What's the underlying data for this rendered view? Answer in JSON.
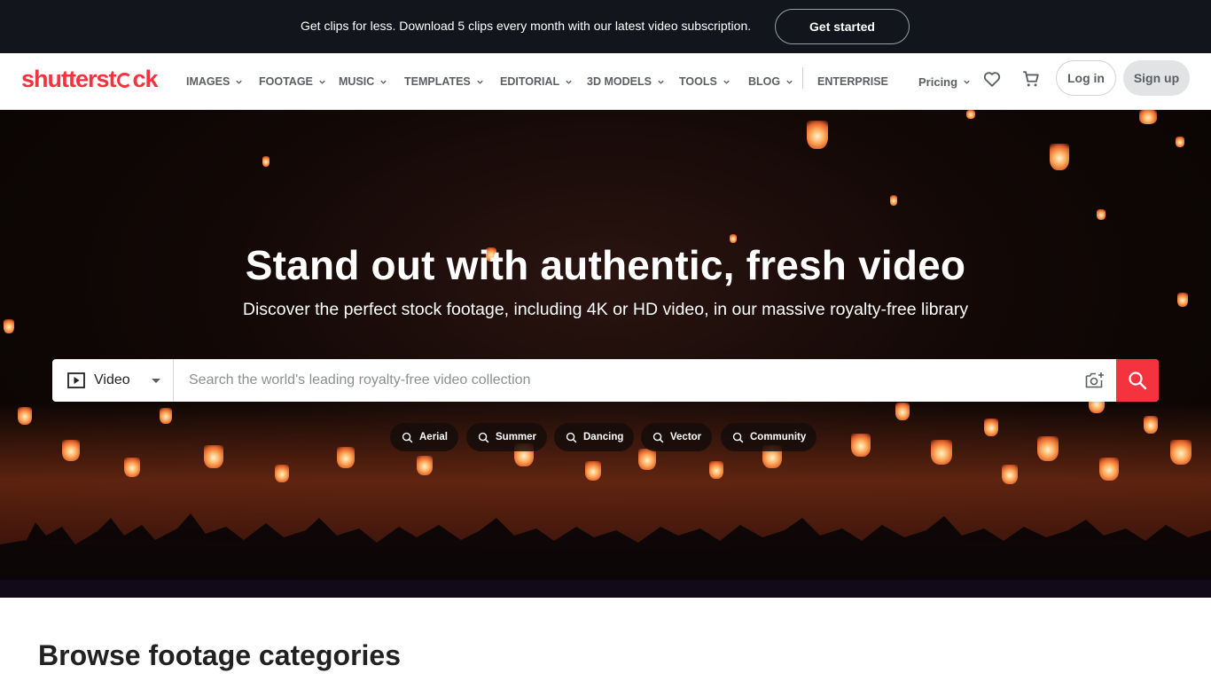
{
  "promo": {
    "text": "Get clips for less. Download 5 clips every month with our latest video subscription.",
    "cta": "Get started"
  },
  "header": {
    "logo_text_start": "shutterst",
    "logo_text_end": "ck",
    "nav": [
      {
        "label": "IMAGES"
      },
      {
        "label": "FOOTAGE"
      },
      {
        "label": "MUSIC"
      },
      {
        "label": "TEMPLATES"
      },
      {
        "label": "EDITORIAL"
      },
      {
        "label": "3D MODELS"
      },
      {
        "label": "TOOLS"
      },
      {
        "label": "BLOG"
      }
    ],
    "enterprise": "ENTERPRISE",
    "pricing": "Pricing",
    "login": "Log in",
    "signup": "Sign up",
    "icons": {
      "favorites": "heart-icon",
      "cart": "cart-icon"
    }
  },
  "hero": {
    "title": "Stand out with authentic, fresh video",
    "subtitle": "Discover the perfect stock footage, including 4K or HD video, in our massive royalty-free library",
    "search": {
      "media_type": "Video",
      "placeholder": "Search the world's leading royalty-free video collection"
    },
    "chips": [
      {
        "label": "Aerial"
      },
      {
        "label": "Summer"
      },
      {
        "label": "Dancing"
      },
      {
        "label": "Vector"
      },
      {
        "label": "Community"
      }
    ]
  },
  "browse": {
    "title": "Browse footage categories"
  },
  "colors": {
    "brand": "#f5333f",
    "banner_bg": "#12151c",
    "nav_text": "#5b5e63"
  }
}
